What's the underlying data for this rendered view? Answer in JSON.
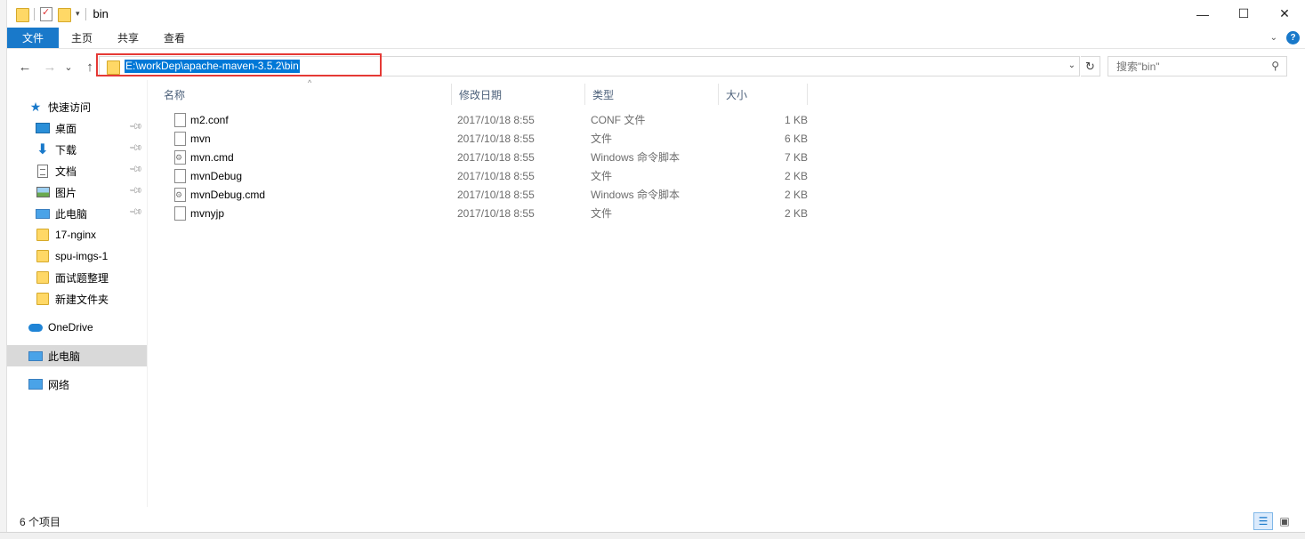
{
  "window": {
    "title": "bin",
    "controls": {
      "minimize": "—",
      "maximize": "☐",
      "close": "✕"
    }
  },
  "ribbon": {
    "tabs": [
      {
        "label": "文件"
      },
      {
        "label": "主页"
      },
      {
        "label": "共享"
      },
      {
        "label": "查看"
      }
    ],
    "help": "?"
  },
  "navbar": {
    "back": "←",
    "forward": "→",
    "recent": "⌄",
    "up": "↑",
    "address": "E:\\workDep\\apache-maven-3.5.2\\bin",
    "refresh": "↻",
    "search_placeholder": "搜索\"bin\""
  },
  "navpane": {
    "items": [
      {
        "label": "快速访问",
        "icon": "star-icon",
        "pinned": false
      },
      {
        "label": "桌面",
        "icon": "desktop-icon",
        "pinned": true
      },
      {
        "label": "下载",
        "icon": "download-icon",
        "pinned": true
      },
      {
        "label": "文档",
        "icon": "document-icon",
        "pinned": true
      },
      {
        "label": "图片",
        "icon": "pictures-icon",
        "pinned": true
      },
      {
        "label": "此电脑",
        "icon": "computer-icon",
        "pinned": true
      },
      {
        "label": "17-nginx",
        "icon": "folder-icon",
        "pinned": false
      },
      {
        "label": "spu-imgs-1",
        "icon": "folder-icon",
        "pinned": false
      },
      {
        "label": "面试题整理",
        "icon": "folder-icon",
        "pinned": false
      },
      {
        "label": "新建文件夹",
        "icon": "folder-icon",
        "pinned": false
      },
      {
        "label": "OneDrive",
        "icon": "cloud-icon",
        "pinned": false
      },
      {
        "label": "此电脑",
        "icon": "computer-icon",
        "pinned": false,
        "selected": true
      },
      {
        "label": "网络",
        "icon": "network-icon",
        "pinned": false
      }
    ]
  },
  "filelist": {
    "columns": [
      "名称",
      "修改日期",
      "类型",
      "大小"
    ],
    "rows": [
      {
        "name": "m2.conf",
        "date": "2017/10/18 8:55",
        "type": "CONF 文件",
        "size": "1 KB",
        "kind": "file"
      },
      {
        "name": "mvn",
        "date": "2017/10/18 8:55",
        "type": "文件",
        "size": "6 KB",
        "kind": "file"
      },
      {
        "name": "mvn.cmd",
        "date": "2017/10/18 8:55",
        "type": "Windows 命令脚本",
        "size": "7 KB",
        "kind": "cmd"
      },
      {
        "name": "mvnDebug",
        "date": "2017/10/18 8:55",
        "type": "文件",
        "size": "2 KB",
        "kind": "file"
      },
      {
        "name": "mvnDebug.cmd",
        "date": "2017/10/18 8:55",
        "type": "Windows 命令脚本",
        "size": "2 KB",
        "kind": "cmd"
      },
      {
        "name": "mvnyjp",
        "date": "2017/10/18 8:55",
        "type": "文件",
        "size": "2 KB",
        "kind": "file"
      }
    ]
  },
  "statusbar": {
    "text": "6 个项目"
  },
  "colors": {
    "accent": "#1979ca",
    "selection": "#0078d7",
    "highlight_box": "#e53935"
  }
}
